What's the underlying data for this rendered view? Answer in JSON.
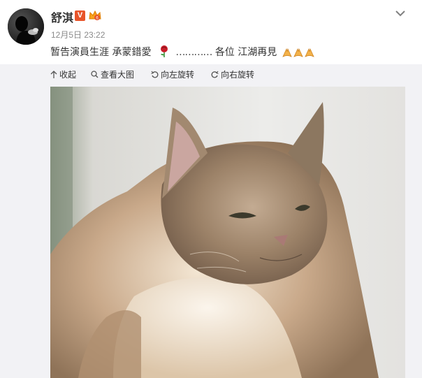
{
  "post": {
    "author": "舒淇",
    "badge": "V",
    "time": "12月5日 23:22",
    "text_part1": "暂告演員生涯  承蒙錯愛",
    "text_dots": "…………",
    "text_part2": "各位 江湖再見"
  },
  "toolbar": {
    "collapse": "收起",
    "view_large": "查看大图",
    "rotate_left": "向左旋转",
    "rotate_right": "向右旋转"
  },
  "icons": {
    "rose": "rose-emoji",
    "pray": "pray-emoji",
    "crown": "crown-badge-icon",
    "more": "chevron-down-icon"
  },
  "colors": {
    "badge": "#e8542a",
    "panel_bg": "#f2f2f5",
    "time": "#8a8a8a"
  }
}
